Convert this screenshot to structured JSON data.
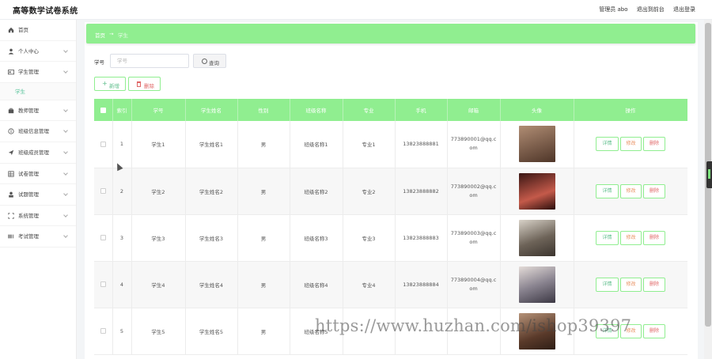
{
  "header": {
    "title": "高等数学试卷系统",
    "links": [
      "管理员 abo",
      "退出到前台",
      "退出登录"
    ]
  },
  "sidebar": {
    "items": [
      {
        "label": "首页",
        "icon": "home-icon",
        "arrow": false
      },
      {
        "label": "个人中心",
        "icon": "user-icon",
        "arrow": true
      },
      {
        "label": "学生管理",
        "icon": "id-card-icon",
        "arrow": true,
        "expanded": true,
        "children": [
          "学生"
        ]
      },
      {
        "label": "教师管理",
        "icon": "briefcase-icon",
        "arrow": true
      },
      {
        "label": "班级信息管理",
        "icon": "info-circle-icon",
        "arrow": true
      },
      {
        "label": "班级成员管理",
        "icon": "send-icon",
        "arrow": true
      },
      {
        "label": "试卷管理",
        "icon": "grid-icon",
        "arrow": true
      },
      {
        "label": "试题管理",
        "icon": "person-icon",
        "arrow": true
      },
      {
        "label": "系统管理",
        "icon": "expand-icon",
        "arrow": true
      },
      {
        "label": "考试管理",
        "icon": "barcode-icon",
        "arrow": true
      }
    ]
  },
  "breadcrumb": {
    "home": "首页",
    "separator": "→",
    "current": "学生"
  },
  "search": {
    "label": "学号",
    "placeholder": "学号",
    "value": "",
    "button_label": "查询"
  },
  "actions": {
    "add_label": "新增",
    "delete_label": "删除"
  },
  "table": {
    "columns": [
      "索引",
      "学号",
      "学生姓名",
      "性别",
      "班级名称",
      "专业",
      "手机",
      "邮箱",
      "头像",
      "操作"
    ],
    "row_buttons": {
      "detail": "详情",
      "edit": "修改",
      "delete": "删除"
    },
    "rows": [
      {
        "index": "1",
        "id": "学生1",
        "name": "学生姓名1",
        "gender": "男",
        "class_name": "班级名称1",
        "major": "专业1",
        "phone": "13823888881",
        "email_l1": "773890001@qq.c",
        "email_l2": "om",
        "avatar_color": "#7b5a48"
      },
      {
        "index": "2",
        "id": "学生2",
        "name": "学生姓名2",
        "gender": "男",
        "class_name": "班级名称2",
        "major": "专业2",
        "phone": "13823888882",
        "email_l1": "773890002@qq.c",
        "email_l2": "om",
        "avatar_color": "#5a2a28"
      },
      {
        "index": "3",
        "id": "学生3",
        "name": "学生姓名3",
        "gender": "男",
        "class_name": "班级名称3",
        "major": "专业3",
        "phone": "13823888883",
        "email_l1": "773890003@qq.c",
        "email_l2": "om",
        "avatar_color": "#8e8478"
      },
      {
        "index": "4",
        "id": "学生4",
        "name": "学生姓名4",
        "gender": "男",
        "class_name": "班级名称4",
        "major": "专业4",
        "phone": "13823888884",
        "email_l1": "773890004@qq.c",
        "email_l2": "om",
        "avatar_color": "#6a6a72"
      },
      {
        "index": "5",
        "id": "学生5",
        "name": "学生姓名5",
        "gender": "男",
        "class_name": "班级名称5",
        "major": "",
        "phone": "",
        "email_l1": "",
        "email_l2": "",
        "avatar_color": "#6a4a3a"
      }
    ]
  },
  "watermark": "https://www.huzhan.com/ishop39397",
  "colors": {
    "accent": "#90ee90",
    "active_text": "#56c39a",
    "danger": "#e06666",
    "warning": "#e89060"
  }
}
